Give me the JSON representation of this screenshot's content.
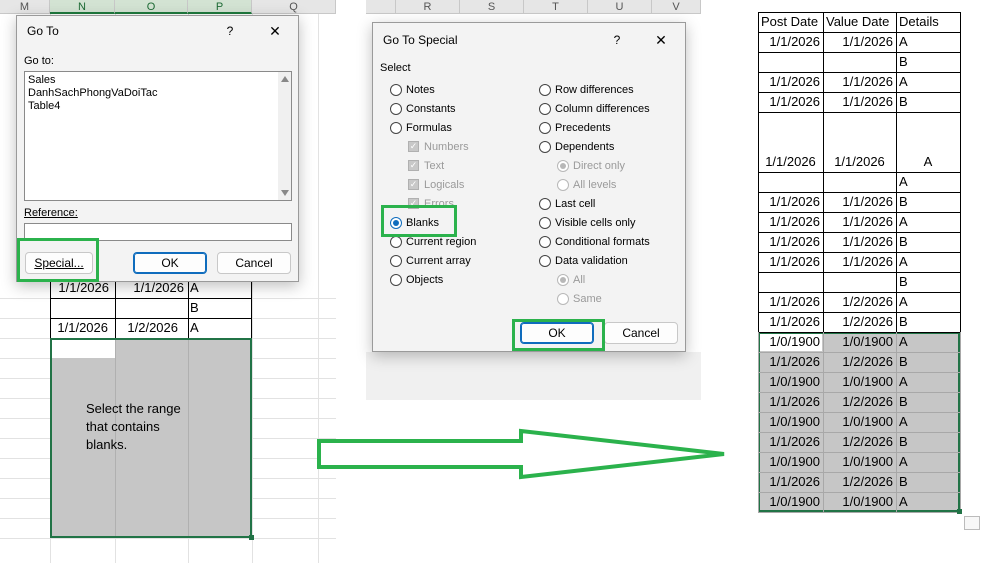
{
  "left_sheet": {
    "columns": [
      "M",
      "N",
      "O",
      "P",
      "Q"
    ],
    "rows": [
      {
        "post": "1/1/2026",
        "value": "1/1/2026",
        "detail": "A"
      },
      {
        "post": "",
        "value": "",
        "detail": "B"
      },
      {
        "post": "1/1/2026",
        "value": "1/2/2026",
        "detail": "A"
      }
    ],
    "annotation": [
      "Select the range",
      "that contains",
      "blanks."
    ]
  },
  "goto_dialog": {
    "title": "Go To",
    "help": "?",
    "close": "✕",
    "goto_label": "Go to:",
    "items": [
      "Sales",
      "DanhSachPhongVaDoiTac",
      "Table4"
    ],
    "reference_label": "Reference:",
    "reference_value": "",
    "special_button": "Special...",
    "ok_button": "OK",
    "cancel_button": "Cancel"
  },
  "middle_sheet": {
    "columns": [
      "R",
      "S",
      "T",
      "U",
      "V"
    ]
  },
  "goto_special_dialog": {
    "title": "Go To Special",
    "help": "?",
    "close": "✕",
    "select_label": "Select",
    "left_options": [
      {
        "label": "Notes",
        "checked": false
      },
      {
        "label": "Constants",
        "checked": false
      },
      {
        "label": "Formulas",
        "checked": false
      }
    ],
    "formula_subs": [
      "Numbers",
      "Text",
      "Logicals",
      "Errors"
    ],
    "left_options_2": [
      {
        "label": "Blanks",
        "checked": true
      },
      {
        "label": "Current region",
        "checked": false
      },
      {
        "label": "Current array",
        "checked": false
      },
      {
        "label": "Objects",
        "checked": false
      }
    ],
    "right_options": [
      {
        "label": "Row differences"
      },
      {
        "label": "Column differences"
      },
      {
        "label": "Precedents"
      },
      {
        "label": "Dependents"
      }
    ],
    "dependents_subs": [
      "Direct only",
      "All levels"
    ],
    "right_options_2": [
      {
        "label": "Last cell"
      },
      {
        "label": "Visible cells only"
      },
      {
        "label": "Conditional formats"
      },
      {
        "label": "Data validation"
      }
    ],
    "validation_subs": [
      "All",
      "Same"
    ],
    "ok_button": "OK",
    "cancel_button": "Cancel"
  },
  "right_table": {
    "headers": [
      "Post Date",
      "Value Date",
      "Details"
    ],
    "rows": [
      [
        "1/1/2026",
        "1/1/2026",
        "A"
      ],
      [
        "",
        "",
        "B"
      ],
      [
        "1/1/2026",
        "1/1/2026",
        "A"
      ],
      [
        "1/1/2026",
        "1/1/2026",
        "B"
      ],
      [
        "1/1/2026",
        "1/1/2026",
        "A"
      ],
      [
        "",
        "",
        "A"
      ],
      [
        "1/1/2026",
        "1/1/2026",
        "B"
      ],
      [
        "1/1/2026",
        "1/1/2026",
        "A"
      ],
      [
        "1/1/2026",
        "1/1/2026",
        "B"
      ],
      [
        "1/1/2026",
        "1/1/2026",
        "A"
      ],
      [
        "",
        "",
        "B"
      ],
      [
        "1/1/2026",
        "1/2/2026",
        "A"
      ],
      [
        "1/1/2026",
        "1/2/2026",
        "B"
      ],
      [
        "1/0/1900",
        "1/0/1900",
        "A"
      ],
      [
        "1/1/2026",
        "1/2/2026",
        "B"
      ],
      [
        "1/0/1900",
        "1/0/1900",
        "A"
      ],
      [
        "1/1/2026",
        "1/2/2026",
        "B"
      ],
      [
        "1/0/1900",
        "1/0/1900",
        "A"
      ],
      [
        "1/1/2026",
        "1/2/2026",
        "B"
      ],
      [
        "1/0/1900",
        "1/0/1900",
        "A"
      ],
      [
        "1/1/2026",
        "1/2/2026",
        "B"
      ],
      [
        "1/0/1900",
        "1/0/1900",
        "A"
      ]
    ]
  },
  "colors": {
    "selection": "#c6c6c6",
    "selection_border": "#217346",
    "highlight": "#2bb24c",
    "arrow": "#2bb24c"
  }
}
